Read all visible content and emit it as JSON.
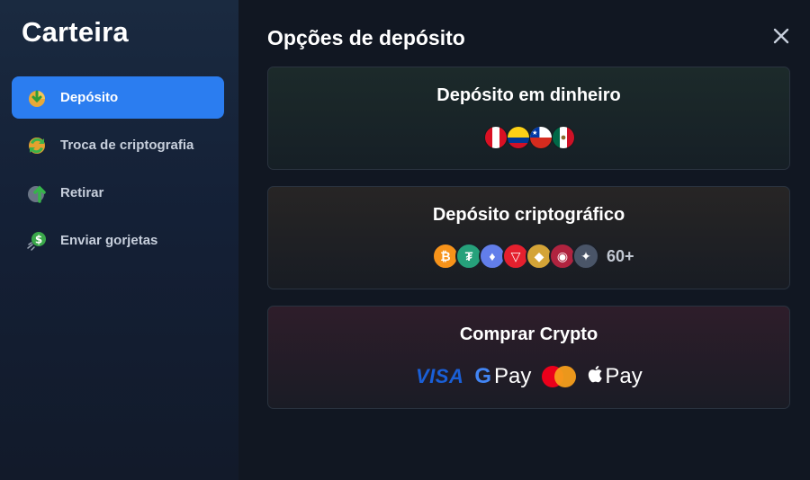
{
  "sidebar": {
    "title": "Carteira",
    "items": [
      {
        "label": "Depósito",
        "icon": "deposit-icon",
        "active": true
      },
      {
        "label": "Troca de criptografia",
        "icon": "exchange-icon",
        "active": false
      },
      {
        "label": "Retirar",
        "icon": "withdraw-icon",
        "active": false
      },
      {
        "label": "Enviar gorjetas",
        "icon": "tip-icon",
        "active": false
      }
    ]
  },
  "main": {
    "title": "Opções de depósito",
    "close_icon": "close-icon",
    "cards": [
      {
        "title": "Depósito em dinheiro",
        "flags": [
          "Peru",
          "Colombia",
          "Chile",
          "Mexico"
        ]
      },
      {
        "title": "Depósito criptográfico",
        "coins": [
          "BTC",
          "USDT",
          "ETH",
          "TRX",
          "BNB",
          "coin",
          "coin"
        ],
        "more": "60+"
      },
      {
        "title": "Comprar Crypto",
        "payments": {
          "visa": "VISA",
          "gpay": "Pay",
          "apple_pay": "Pay"
        }
      }
    ]
  },
  "colors": {
    "accent": "#2b7df0",
    "background": "#111722",
    "sidebar": "#17253a"
  }
}
